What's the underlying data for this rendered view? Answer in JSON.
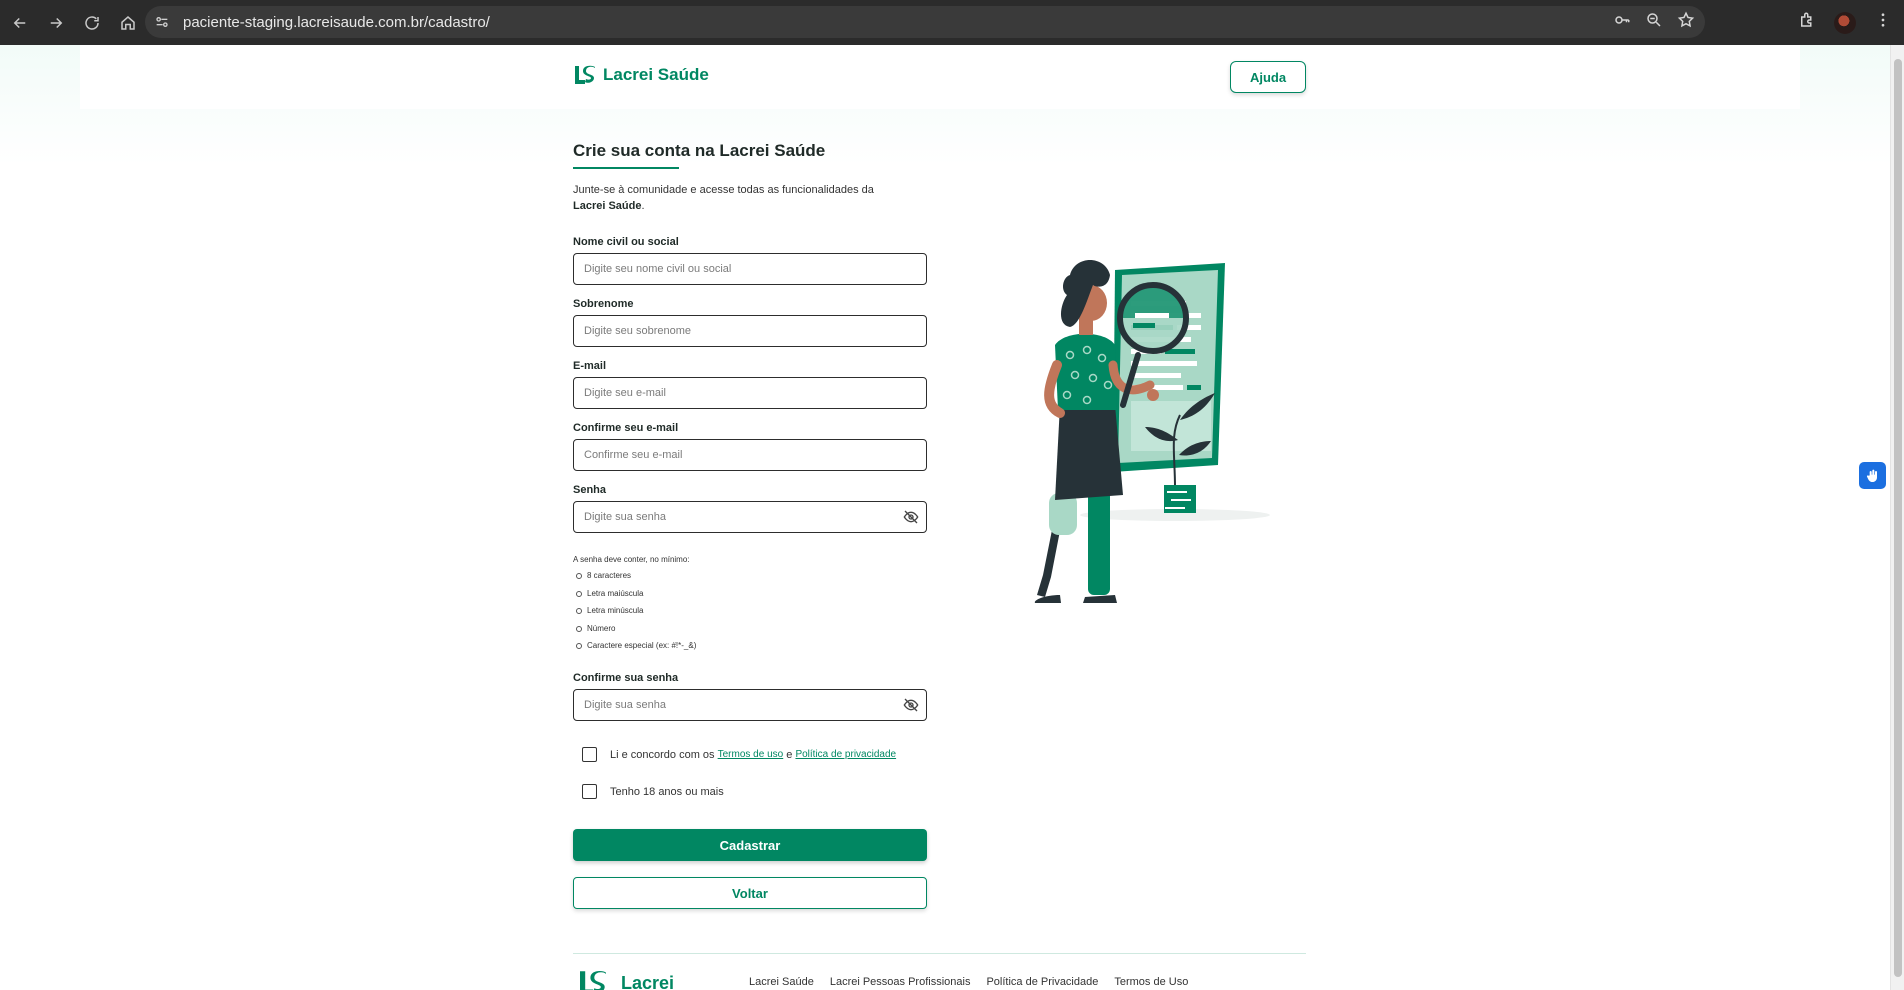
{
  "browser": {
    "url": "paciente-staging.lacreisaude.com.br/cadastro/"
  },
  "header": {
    "brand": "Lacrei Saúde",
    "help_label": "Ajuda"
  },
  "form": {
    "title": "Crie sua conta na Lacrei Saúde",
    "intro_prefix": "Junte-se à comunidade e acesse todas as funcionalidades da ",
    "intro_brand": "Lacrei Saúde",
    "intro_suffix": ".",
    "fields": [
      {
        "label": "Nome civil ou social",
        "placeholder": "Digite seu nome civil ou social"
      },
      {
        "label": "Sobrenome",
        "placeholder": "Digite seu sobrenome"
      },
      {
        "label": "E-mail",
        "placeholder": "Digite seu e-mail"
      },
      {
        "label": "Confirme seu e-mail",
        "placeholder": "Confirme seu e-mail"
      },
      {
        "label": "Senha",
        "placeholder": "Digite sua senha"
      }
    ],
    "password_rules_title": "A senha deve conter, no mínimo:",
    "password_rules": [
      "8 caracteres",
      "Letra maiúscula",
      "Letra minúscula",
      "Número",
      "Caractere especial  (ex: #!*-_&)"
    ],
    "confirm_password": {
      "label": "Confirme sua senha",
      "placeholder": "Digite sua senha"
    },
    "terms": {
      "prefix": "Li e concordo com os ",
      "terms_link": "Termos de uso",
      "middle": " e ",
      "privacy_link": "Política de privacidade"
    },
    "age_check": "Tenho 18 anos ou mais",
    "submit_label": "Cadastrar",
    "back_label": "Voltar"
  },
  "footer": {
    "brand": "Lacrei",
    "links": [
      "Lacrei Saúde",
      "Lacrei Pessoas Profissionais",
      "Política de Privacidade",
      "Termos de Uso"
    ]
  },
  "colors": {
    "brand_green": "#018762",
    "accessibility_blue": "#1b6fe0"
  }
}
